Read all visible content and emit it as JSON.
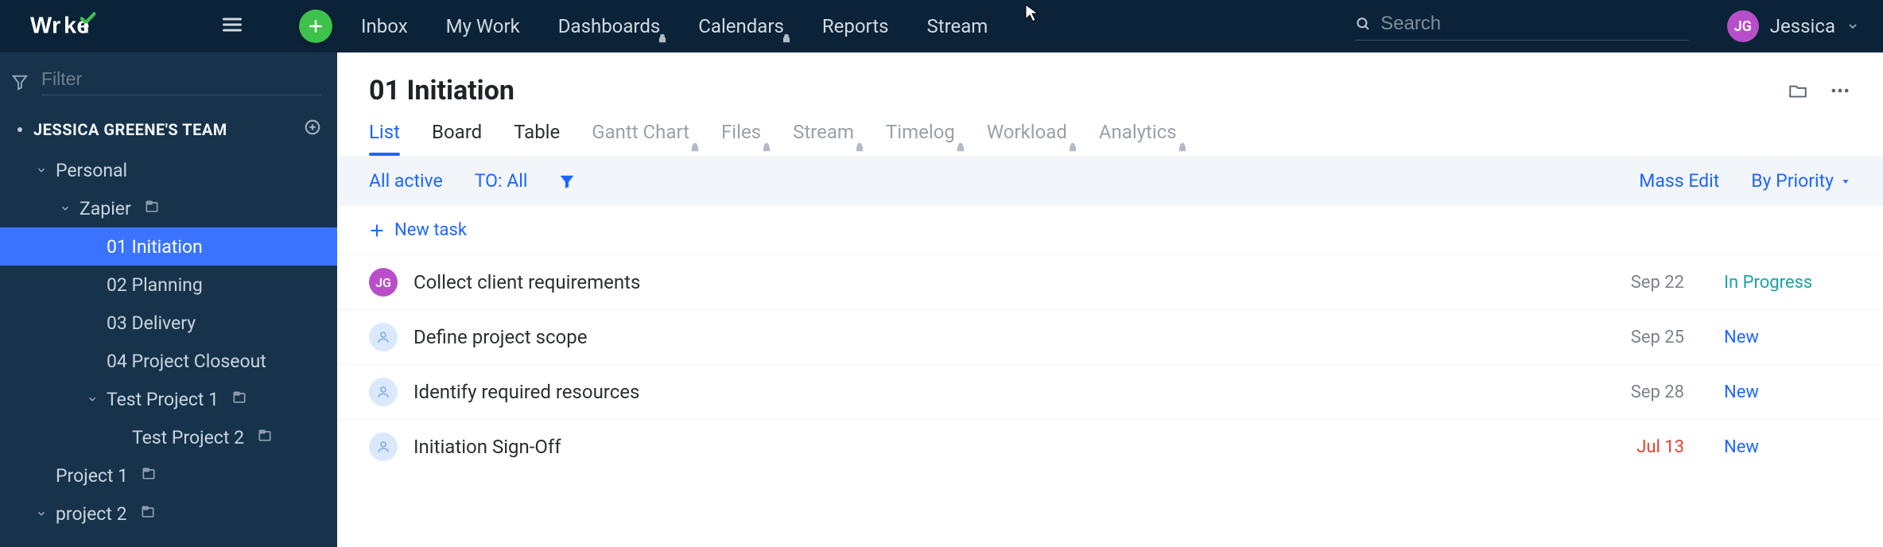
{
  "brand": "Wrike",
  "nav": {
    "links": [
      {
        "label": "Inbox",
        "locked": false
      },
      {
        "label": "My Work",
        "locked": false
      },
      {
        "label": "Dashboards",
        "locked": true
      },
      {
        "label": "Calendars",
        "locked": true
      },
      {
        "label": "Reports",
        "locked": false
      },
      {
        "label": "Stream",
        "locked": false
      }
    ],
    "search_placeholder": "Search"
  },
  "user": {
    "initials": "JG",
    "name": "Jessica"
  },
  "sidebar": {
    "filter_placeholder": "Filter",
    "team_label": "JESSICA GREENE'S TEAM",
    "items": [
      {
        "label": "Personal",
        "level": 0,
        "expanded": true,
        "icon": "chevron",
        "active": false,
        "folder": false
      },
      {
        "label": "Zapier",
        "level": 1,
        "expanded": true,
        "icon": "chevron",
        "active": false,
        "folder": true
      },
      {
        "label": "01 Initiation",
        "level": 2,
        "expanded": false,
        "icon": "none",
        "active": true,
        "folder": false
      },
      {
        "label": "02 Planning",
        "level": 2,
        "expanded": false,
        "icon": "none",
        "active": false,
        "folder": false
      },
      {
        "label": "03 Delivery",
        "level": 2,
        "expanded": false,
        "icon": "none",
        "active": false,
        "folder": false
      },
      {
        "label": "04 Project Closeout",
        "level": 2,
        "expanded": false,
        "icon": "none",
        "active": false,
        "folder": false
      },
      {
        "label": "Test Project 1",
        "level": 2,
        "expanded": true,
        "icon": "chevron",
        "active": false,
        "folder": true
      },
      {
        "label": "Test Project 2",
        "level": 3,
        "expanded": false,
        "icon": "none",
        "active": false,
        "folder": true
      },
      {
        "label": "Project 1",
        "level": 0,
        "expanded": false,
        "icon": "none",
        "active": false,
        "folder": true
      },
      {
        "label": "project 2",
        "level": 0,
        "expanded": true,
        "icon": "chevron",
        "active": false,
        "folder": true
      }
    ]
  },
  "main": {
    "title": "01 Initiation",
    "tabs": [
      {
        "label": "List",
        "state": "active"
      },
      {
        "label": "Board",
        "state": "enabled"
      },
      {
        "label": "Table",
        "state": "enabled"
      },
      {
        "label": "Gantt Chart",
        "state": "locked"
      },
      {
        "label": "Files",
        "state": "locked"
      },
      {
        "label": "Stream",
        "state": "locked"
      },
      {
        "label": "Timelog",
        "state": "locked"
      },
      {
        "label": "Workload",
        "state": "locked"
      },
      {
        "label": "Analytics",
        "state": "locked"
      }
    ],
    "filterbar": {
      "all_active": "All active",
      "to_all": "TO: All",
      "mass_edit": "Mass Edit",
      "sort": "By Priority"
    },
    "new_task": "New task",
    "tasks": [
      {
        "assignee": "JG",
        "avatar": "jg",
        "name": "Collect client requirements",
        "date": "Sep 22",
        "overdue": false,
        "status": "In Progress",
        "status_kind": "progress"
      },
      {
        "assignee": "",
        "avatar": "anon",
        "name": "Define project scope",
        "date": "Sep 25",
        "overdue": false,
        "status": "New",
        "status_kind": "new"
      },
      {
        "assignee": "",
        "avatar": "anon",
        "name": "Identify required resources",
        "date": "Sep 28",
        "overdue": false,
        "status": "New",
        "status_kind": "new"
      },
      {
        "assignee": "",
        "avatar": "anon",
        "name": "Initiation Sign-Off",
        "date": "Jul 13",
        "overdue": true,
        "status": "New",
        "status_kind": "new"
      }
    ]
  }
}
